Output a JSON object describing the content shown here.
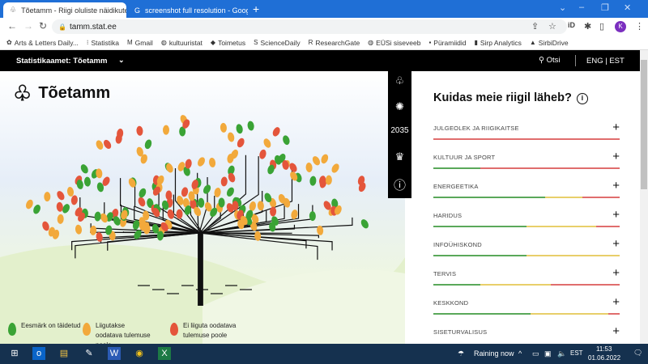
{
  "browser": {
    "tabs": [
      {
        "title": "Tõetamm - Riigi oluliste näidikute",
        "active": true
      },
      {
        "title": "screenshot full resolution - Goog",
        "active": false
      }
    ],
    "url": "tamm.stat.ee",
    "profile_initial": "K",
    "bookmarks": [
      "Arts & Letters Daily...",
      "Statistika",
      "Gmail",
      "kultuuristat",
      "Toimetus",
      "ScienceDaily",
      "ResearchGate",
      "EÜSi siseveeb",
      "Püramiidid",
      "Sirp Analytics",
      "SirbiDrive"
    ]
  },
  "header": {
    "brand": "Statistikaamet:  Tõetamm",
    "search": "Otsi",
    "lang": "ENG  |  EST"
  },
  "hero": {
    "title": "Tõetamm",
    "legend": [
      {
        "label": "Eesmärk on täidetud",
        "color": "#3aa335"
      },
      {
        "label": "Liigutakse oodatava tulemuse poole",
        "color": "#f2a93b"
      },
      {
        "label": "Ei liiguta oodatava tulemuse poole",
        "color": "#e4553b"
      }
    ]
  },
  "panel": {
    "title": "Kuidas meie riigil läheb?",
    "colors": {
      "green": "#5aa85a",
      "yellow": "#e8cf6a",
      "red": "#e06d6d"
    },
    "categories": [
      {
        "label": "JULGEOLEK JA RIIGIKAITSE",
        "green": 0,
        "yellow": 0,
        "red": 100
      },
      {
        "label": "KULTUUR JA SPORT",
        "green": 25,
        "yellow": 0,
        "red": 75
      },
      {
        "label": "ENERGEETIKA",
        "green": 60,
        "yellow": 20,
        "red": 20
      },
      {
        "label": "HARIDUS",
        "green": 50,
        "yellow": 37.5,
        "red": 12.5
      },
      {
        "label": "INFOÜHISKOND",
        "green": 50,
        "yellow": 50,
        "red": 0
      },
      {
        "label": "TERVIS",
        "green": 25,
        "yellow": 38,
        "red": 37
      },
      {
        "label": "KESKKOND",
        "green": 52,
        "yellow": 42,
        "red": 6
      },
      {
        "label": "SISETURVALISUS"
      }
    ]
  },
  "taskbar": {
    "weather": "Raining now",
    "lang": "EST",
    "time": "11:53",
    "date": "01.06.2022",
    "notifications": "1"
  }
}
